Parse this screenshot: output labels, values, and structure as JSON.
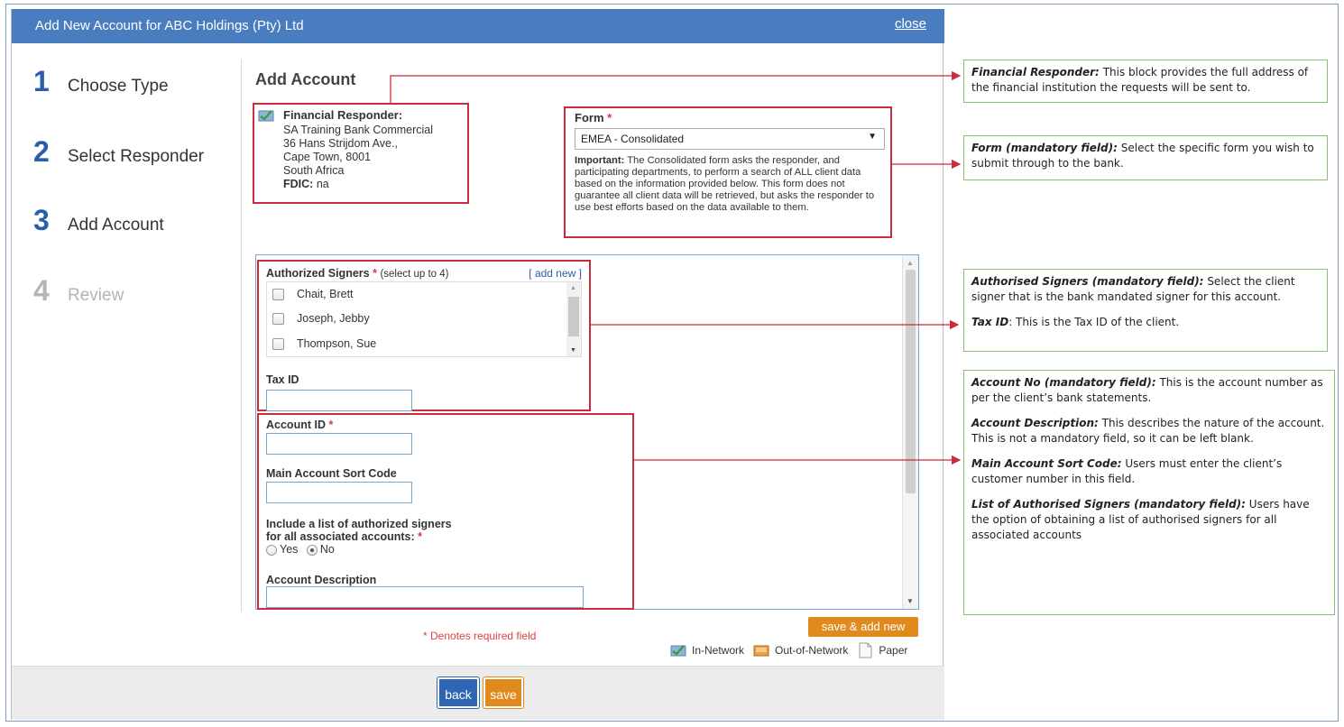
{
  "dialog": {
    "title": "Add New Account for ABC Holdings (Pty) Ltd",
    "close_label": "close"
  },
  "steps": [
    {
      "num": "1",
      "label": "Choose Type"
    },
    {
      "num": "2",
      "label": "Select Responder"
    },
    {
      "num": "3",
      "label": "Add Account"
    },
    {
      "num": "4",
      "label": "Review"
    }
  ],
  "main": {
    "title": "Add Account",
    "responder": {
      "label": "Financial Responder:",
      "lines": [
        "SA Training Bank Commercial",
        "36 Hans Strijdom Ave.,",
        "Cape Town, 8001",
        "South Africa"
      ],
      "fdic_label": "FDIC:",
      "fdic_value": "na"
    },
    "form": {
      "label": "Form",
      "selected": "EMEA - Consolidated",
      "note_bold": "Important:",
      "note": "The Consolidated form asks the responder, and participating departments, to perform a search of ALL client data based on the information provided below. This form does not guarantee all client data will be retrieved, but asks the responder to use best efforts based on the data available to them."
    },
    "signers": {
      "label": "Authorized Signers",
      "hint": "(select up to 4)",
      "add_new": "[ add new ]",
      "items": [
        "Chait, Brett",
        "Joseph, Jebby",
        "Thompson, Sue"
      ]
    },
    "tax_id_label": "Tax ID",
    "account_id_label": "Account ID",
    "sort_code_label": "Main Account Sort Code",
    "include_signers_label_1": "Include a list of authorized signers",
    "include_signers_label_2": "for all associated accounts:",
    "radio_yes": "Yes",
    "radio_no": "No",
    "account_description_label": "Account Description"
  },
  "footer": {
    "save_add_new": "save & add new",
    "required_note": "* Denotes required field",
    "legend": [
      "In-Network",
      "Out-of-Network",
      "Paper"
    ],
    "back": "back",
    "save": "save"
  },
  "annotations": {
    "responder": {
      "title": "Financial Responder:",
      "text": "This block provides the full address of the financial institution the requests will be sent to."
    },
    "form": {
      "title": "Form (mandatory field):",
      "text": "Select the specific form you wish to submit through to the bank."
    },
    "signers": {
      "title": "Authorised Signers (mandatory field):",
      "text": "Select the client signer that is the bank mandated signer for this account."
    },
    "taxid": {
      "title": "Tax ID",
      "text": ": This is the Tax ID of the client."
    },
    "account_no": {
      "title": "Account No (mandatory field):",
      "text": "This is the account number as per the client’s bank statements."
    },
    "account_desc": {
      "title": "Account Description:",
      "text": "This describes the nature of the account. This is not a mandatory field, so it can be left blank."
    },
    "sort_code": {
      "title": "Main Account Sort Code:",
      "text": "Users must enter the client’s customer number in this field."
    },
    "list_signers": {
      "title": "List of Authorised Signers (mandatory field):",
      "text": "Users have the option of obtaining a list of authorised signers for all associated accounts"
    }
  },
  "colors": {
    "header_blue": "#4a7dbf",
    "step_blue": "#2a5fa8",
    "highlight_red": "#cc2b3b",
    "callout_green": "#88c070",
    "button_orange": "#e08a1e"
  }
}
